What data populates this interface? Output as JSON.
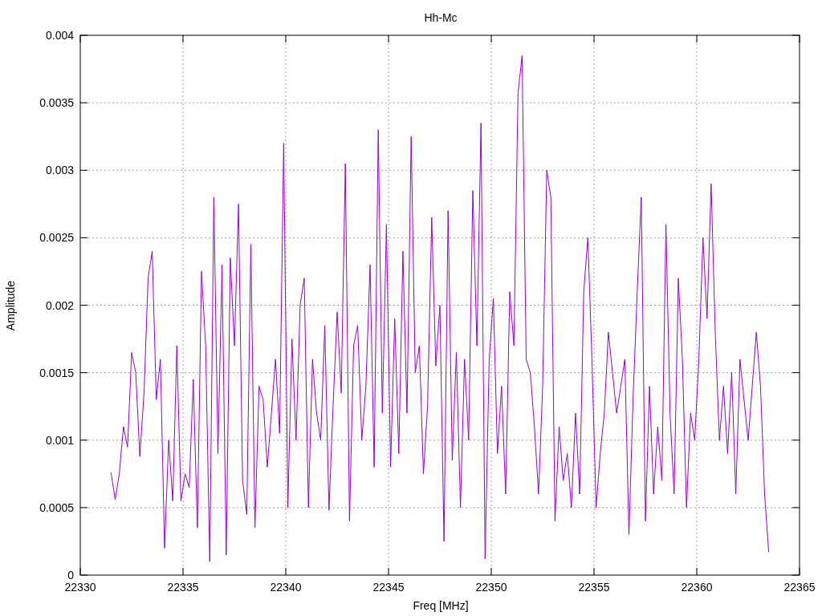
{
  "chart_data": {
    "type": "line",
    "title": "Hh-Mc",
    "xlabel": "Freq [MHz]",
    "ylabel": "Amplitude",
    "xlim": [
      22330,
      22365
    ],
    "ylim": [
      0,
      0.004
    ],
    "grid": true,
    "xticks": [
      22330,
      22335,
      22340,
      22345,
      22350,
      22355,
      22360,
      22365
    ],
    "yticks": [
      0,
      0.0005,
      0.001,
      0.0015,
      0.002,
      0.0025,
      0.003,
      0.0035,
      0.004
    ],
    "x": [
      22331.5,
      22331.7,
      22331.9,
      22332.1,
      22332.3,
      22332.5,
      22332.7,
      22332.9,
      22333.1,
      22333.3,
      22333.5,
      22333.7,
      22333.9,
      22334.1,
      22334.3,
      22334.5,
      22334.7,
      22334.9,
      22335.1,
      22335.3,
      22335.5,
      22335.7,
      22335.9,
      22336.1,
      22336.3,
      22336.5,
      22336.7,
      22336.9,
      22337.1,
      22337.3,
      22337.5,
      22337.7,
      22337.9,
      22338.1,
      22338.3,
      22338.5,
      22338.7,
      22338.9,
      22339.1,
      22339.3,
      22339.5,
      22339.7,
      22339.9,
      22340.1,
      22340.3,
      22340.5,
      22340.7,
      22340.9,
      22341.1,
      22341.3,
      22341.5,
      22341.7,
      22341.9,
      22342.1,
      22342.3,
      22342.5,
      22342.7,
      22342.9,
      22343.1,
      22343.3,
      22343.5,
      22343.7,
      22343.9,
      22344.1,
      22344.3,
      22344.5,
      22344.7,
      22344.9,
      22345.1,
      22345.3,
      22345.5,
      22345.7,
      22345.9,
      22346.1,
      22346.3,
      22346.5,
      22346.7,
      22346.9,
      22347.1,
      22347.3,
      22347.5,
      22347.7,
      22347.9,
      22348.1,
      22348.3,
      22348.5,
      22348.7,
      22348.9,
      22349.1,
      22349.3,
      22349.5,
      22349.7,
      22349.9,
      22350.1,
      22350.3,
      22350.5,
      22350.7,
      22350.9,
      22351.1,
      22351.3,
      22351.5,
      22351.7,
      22351.9,
      22352.1,
      22352.3,
      22352.5,
      22352.7,
      22352.9,
      22353.1,
      22353.3,
      22353.5,
      22353.7,
      22353.9,
      22354.1,
      22354.3,
      22354.5,
      22354.7,
      22354.9,
      22355.1,
      22355.3,
      22355.5,
      22355.7,
      22355.9,
      22356.1,
      22356.3,
      22356.5,
      22356.7,
      22356.9,
      22357.1,
      22357.3,
      22357.5,
      22357.7,
      22357.9,
      22358.1,
      22358.3,
      22358.5,
      22358.7,
      22358.9,
      22359.1,
      22359.3,
      22359.5,
      22359.7,
      22359.9,
      22360.1,
      22360.3,
      22360.5,
      22360.7,
      22360.9,
      22361.1,
      22361.3,
      22361.5,
      22361.7,
      22361.9,
      22362.1,
      22362.3,
      22362.5,
      22362.7,
      22362.9,
      22363.1,
      22363.3,
      22363.5
    ],
    "series": [
      {
        "color": "#9400d3",
        "values": [
          0.00076,
          0.00056,
          0.00075,
          0.0011,
          0.00095,
          0.00165,
          0.0015,
          0.00088,
          0.00135,
          0.0022,
          0.0024,
          0.0013,
          0.0016,
          0.0002,
          0.001,
          0.00055,
          0.0017,
          0.00055,
          0.00075,
          0.00065,
          0.00145,
          0.00035,
          0.00225,
          0.0017,
          0.0001,
          0.0028,
          0.0009,
          0.0023,
          0.00015,
          0.00235,
          0.0017,
          0.00275,
          0.0007,
          0.00045,
          0.00245,
          0.00035,
          0.0014,
          0.0013,
          0.0008,
          0.0012,
          0.0016,
          0.00105,
          0.0032,
          0.0005,
          0.00175,
          0.001,
          0.002,
          0.0022,
          0.0005,
          0.0016,
          0.0012,
          0.001,
          0.00185,
          0.00048,
          0.00125,
          0.00195,
          0.00135,
          0.00305,
          0.0004,
          0.0017,
          0.00185,
          0.001,
          0.0014,
          0.0023,
          0.0008,
          0.0033,
          0.0012,
          0.0026,
          0.0008,
          0.0019,
          0.0009,
          0.0024,
          0.0012,
          0.00325,
          0.0015,
          0.0017,
          0.00075,
          0.00125,
          0.00265,
          0.00155,
          0.002,
          0.00025,
          0.0027,
          0.00085,
          0.00165,
          0.0005,
          0.0016,
          0.001,
          0.00285,
          0.0017,
          0.00335,
          0.00012,
          0.0016,
          0.00205,
          0.0009,
          0.0014,
          0.0006,
          0.0021,
          0.0017,
          0.00357,
          0.00385,
          0.0016,
          0.0015,
          0.0011,
          0.0006,
          0.0014,
          0.003,
          0.0028,
          0.0004,
          0.0011,
          0.0007,
          0.0009,
          0.0005,
          0.0012,
          0.0006,
          0.0021,
          0.0025,
          0.0016,
          0.0005,
          0.0009,
          0.0012,
          0.0018,
          0.0015,
          0.0012,
          0.0014,
          0.0016,
          0.0003,
          0.0013,
          0.0021,
          0.0028,
          0.0004,
          0.0014,
          0.0006,
          0.0011,
          0.0007,
          0.0026,
          0.0012,
          0.0006,
          0.0022,
          0.0016,
          0.0005,
          0.0012,
          0.001,
          0.0016,
          0.0025,
          0.0019,
          0.0029,
          0.0018,
          0.001,
          0.0014,
          0.0009,
          0.0015,
          0.0006,
          0.0016,
          0.0013,
          0.001,
          0.0014,
          0.0018,
          0.0014,
          0.0006,
          0.00017
        ]
      }
    ]
  }
}
